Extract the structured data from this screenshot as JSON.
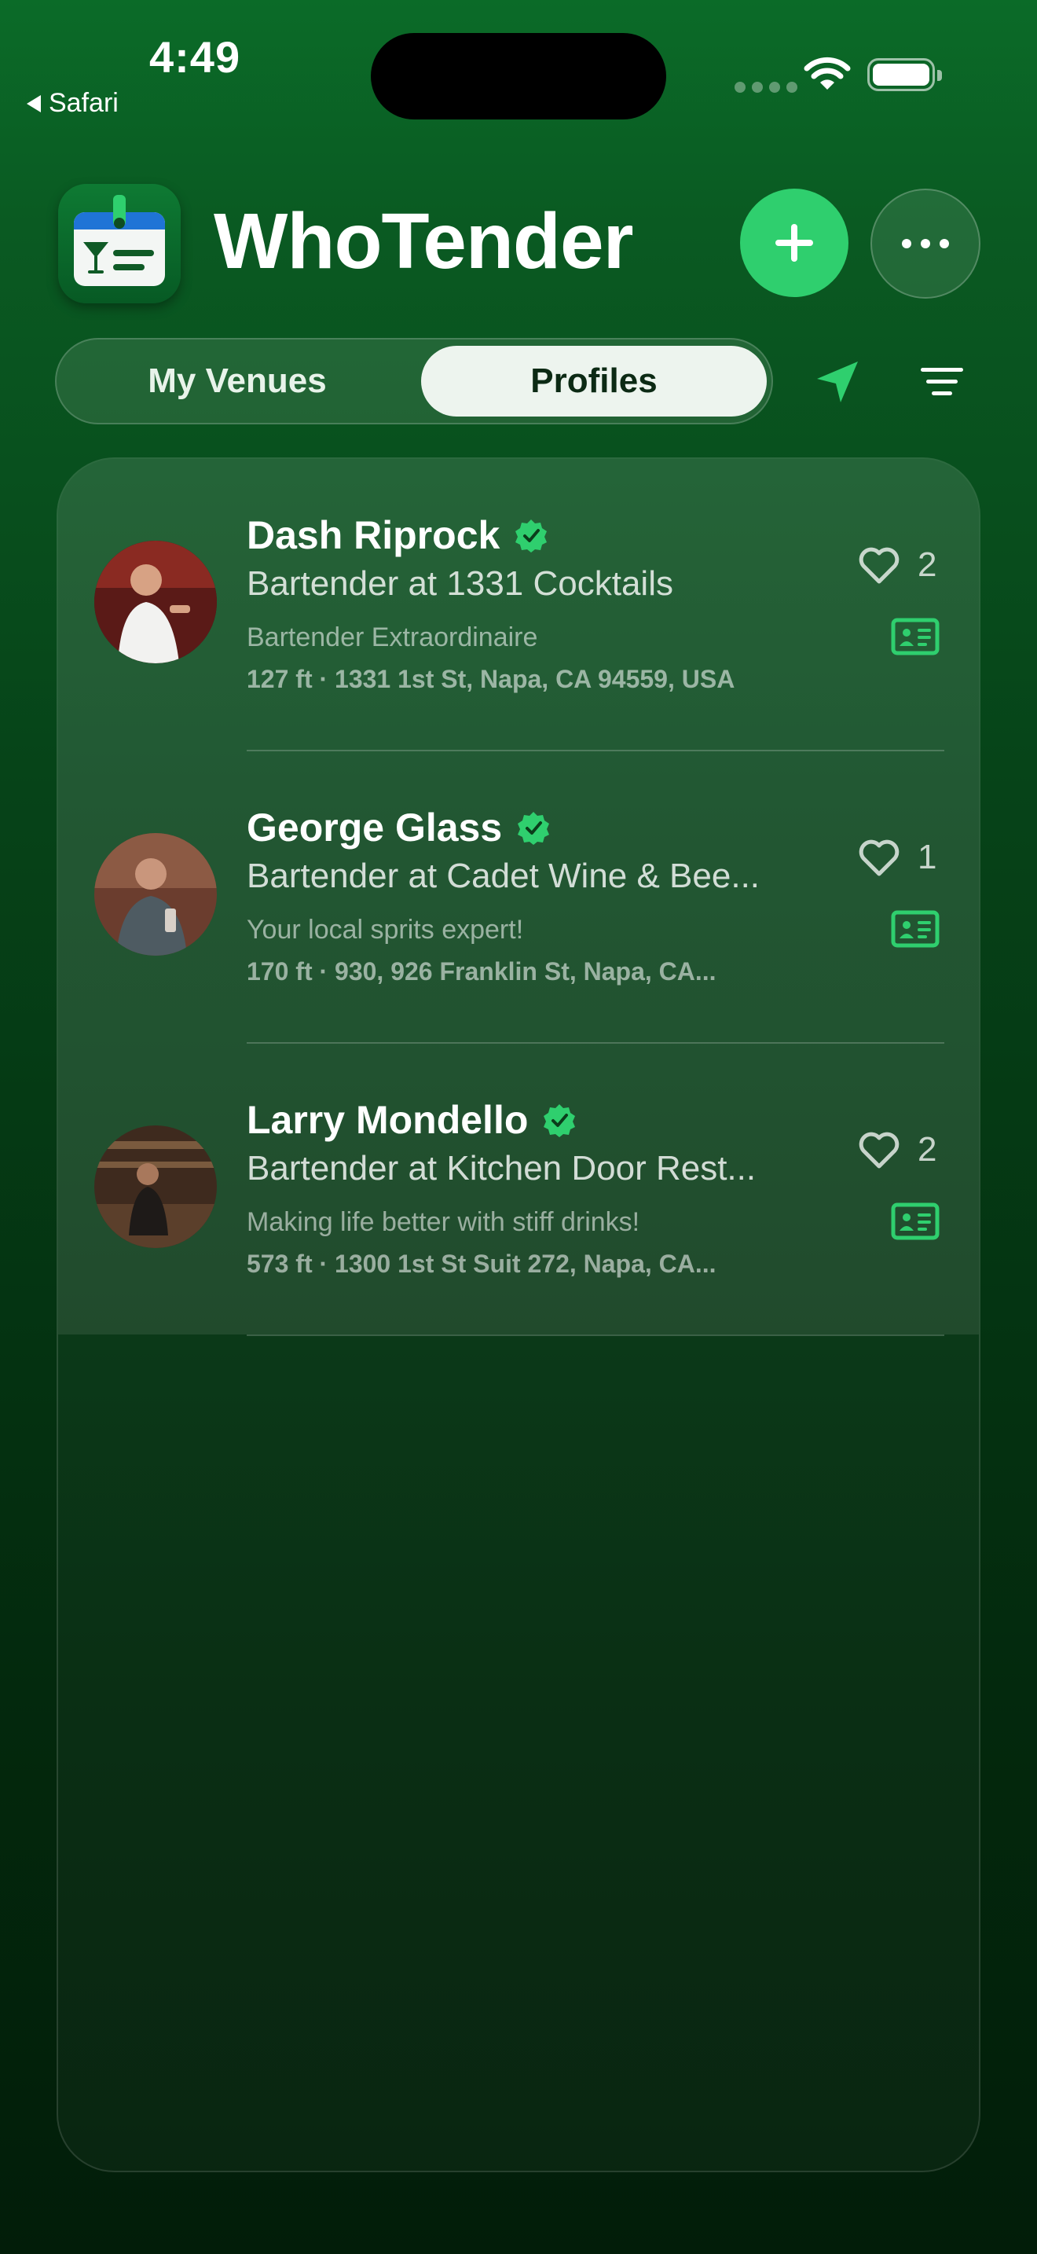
{
  "status_bar": {
    "time": "4:49",
    "back_label": "Safari"
  },
  "header": {
    "title": "WhoTender",
    "add_button_icon": "plus-icon",
    "more_button_icon": "ellipsis-icon"
  },
  "segments": {
    "items": [
      "My Venues",
      "Profiles"
    ],
    "selected": "Profiles"
  },
  "toolbar": {
    "location_icon": "location-arrow-icon",
    "filter_icon": "filter-lines-icon"
  },
  "profiles": [
    {
      "name": "Dash Riprock",
      "verified": true,
      "subtitle": "Bartender at 1331 Cocktails",
      "tagline": "Bartender Extraordinaire",
      "address": "127 ft · 1331 1st St, Napa, CA 94559, USA",
      "likes": "2"
    },
    {
      "name": "George Glass",
      "verified": true,
      "subtitle": "Bartender at Cadet Wine & Bee...",
      "tagline": "Your local sprits expert!",
      "address": "170 ft · 930, 926 Franklin St, Napa, CA...",
      "likes": "1"
    },
    {
      "name": "Larry Mondello",
      "verified": true,
      "subtitle": "Bartender at Kitchen Door Rest...",
      "tagline": "Making life better with stiff drinks!",
      "address": "573 ft · 1300 1st St Suit 272, Napa, CA...",
      "likes": "2"
    }
  ],
  "colors": {
    "accent": "#2fcf6e",
    "background_top": "#0b6b28",
    "background_bottom": "#021d09"
  }
}
